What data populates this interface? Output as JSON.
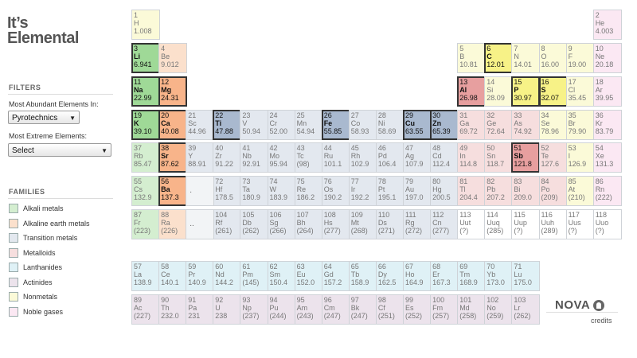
{
  "app": {
    "title_line1": "It’s",
    "title_line2": "Elemental"
  },
  "filters": {
    "heading": "FILTERS",
    "abundant_label": "Most Abundant Elements In:",
    "abundant_value": "Pyrotechnics",
    "extreme_label": "Most Extreme Elements:",
    "extreme_value": "Select"
  },
  "families": {
    "heading": "FAMILIES",
    "items": [
      {
        "key": "alkali",
        "label": "Alkali metals",
        "color": "#d4eed0"
      },
      {
        "key": "alkaline",
        "label": "Alkaline earth metals",
        "color": "#fbe0cc"
      },
      {
        "key": "transition",
        "label": "Transition metals",
        "color": "#e3e8ef"
      },
      {
        "key": "metalloid",
        "label": "Metalloids",
        "color": "#f6dede"
      },
      {
        "key": "lanthanide",
        "label": "Lanthanides",
        "color": "#dff1f6"
      },
      {
        "key": "actinide",
        "label": "Actinides",
        "color": "#ece3ec"
      },
      {
        "key": "nonmetal",
        "label": "Nonmetals",
        "color": "#fbfad8"
      },
      {
        "key": "noble",
        "label": "Noble gases",
        "color": "#fbe8f3"
      }
    ]
  },
  "placeholders": [
    {
      "row": 6,
      "col": 3,
      "text": "."
    },
    {
      "row": 7,
      "col": 3,
      "text": ".."
    }
  ],
  "elements": [
    {
      "n": "1",
      "s": "H",
      "m": "1.008",
      "row": 1,
      "col": 1,
      "cat": "nonmetal"
    },
    {
      "n": "2",
      "s": "He",
      "m": "4.003",
      "row": 1,
      "col": 18,
      "cat": "noble"
    },
    {
      "n": "3",
      "s": "Li",
      "m": "6.941",
      "row": 2,
      "col": 1,
      "cat": "alkali",
      "hl": true
    },
    {
      "n": "4",
      "s": "Be",
      "m": "9.012",
      "row": 2,
      "col": 2,
      "cat": "alkaline"
    },
    {
      "n": "5",
      "s": "B",
      "m": "10.81",
      "row": 2,
      "col": 13,
      "cat": "nonmetal"
    },
    {
      "n": "6",
      "s": "C",
      "m": "12.01",
      "row": 2,
      "col": 14,
      "cat": "nonmetal",
      "hl": true
    },
    {
      "n": "7",
      "s": "N",
      "m": "14.01",
      "row": 2,
      "col": 15,
      "cat": "nonmetal"
    },
    {
      "n": "8",
      "s": "O",
      "m": "16.00",
      "row": 2,
      "col": 16,
      "cat": "nonmetal"
    },
    {
      "n": "9",
      "s": "F",
      "m": "19.00",
      "row": 2,
      "col": 17,
      "cat": "nonmetal"
    },
    {
      "n": "10",
      "s": "Ne",
      "m": "20.18",
      "row": 2,
      "col": 18,
      "cat": "noble"
    },
    {
      "n": "11",
      "s": "Na",
      "m": "22.99",
      "row": 3,
      "col": 1,
      "cat": "alkali",
      "hl": true
    },
    {
      "n": "12",
      "s": "Mg",
      "m": "24.31",
      "row": 3,
      "col": 2,
      "cat": "alkaline",
      "hl": true
    },
    {
      "n": "13",
      "s": "Al",
      "m": "26.98",
      "row": 3,
      "col": 13,
      "cat": "metalloid",
      "hl": true
    },
    {
      "n": "14",
      "s": "Si",
      "m": "28.09",
      "row": 3,
      "col": 14,
      "cat": "nonmetal"
    },
    {
      "n": "15",
      "s": "P",
      "m": "30.97",
      "row": 3,
      "col": 15,
      "cat": "nonmetal",
      "hl": true
    },
    {
      "n": "16",
      "s": "S",
      "m": "32.07",
      "row": 3,
      "col": 16,
      "cat": "nonmetal",
      "hl": true
    },
    {
      "n": "17",
      "s": "Cl",
      "m": "35.45",
      "row": 3,
      "col": 17,
      "cat": "nonmetal"
    },
    {
      "n": "18",
      "s": "Ar",
      "m": "39.95",
      "row": 3,
      "col": 18,
      "cat": "noble"
    },
    {
      "n": "19",
      "s": "K",
      "m": "39.10",
      "row": 4,
      "col": 1,
      "cat": "alkali",
      "hl": true
    },
    {
      "n": "20",
      "s": "Ca",
      "m": "40.08",
      "row": 4,
      "col": 2,
      "cat": "alkaline",
      "hl": true
    },
    {
      "n": "21",
      "s": "Sc",
      "m": "44.96",
      "row": 4,
      "col": 3,
      "cat": "transition"
    },
    {
      "n": "22",
      "s": "Ti",
      "m": "47.88",
      "row": 4,
      "col": 4,
      "cat": "transition",
      "hl": true
    },
    {
      "n": "23",
      "s": "V",
      "m": "50.94",
      "row": 4,
      "col": 5,
      "cat": "transition"
    },
    {
      "n": "24",
      "s": "Cr",
      "m": "52.00",
      "row": 4,
      "col": 6,
      "cat": "transition"
    },
    {
      "n": "25",
      "s": "Mn",
      "m": "54.94",
      "row": 4,
      "col": 7,
      "cat": "transition"
    },
    {
      "n": "26",
      "s": "Fe",
      "m": "55.85",
      "row": 4,
      "col": 8,
      "cat": "transition",
      "hl": true
    },
    {
      "n": "27",
      "s": "Co",
      "m": "58.93",
      "row": 4,
      "col": 9,
      "cat": "transition"
    },
    {
      "n": "28",
      "s": "Ni",
      "m": "58.69",
      "row": 4,
      "col": 10,
      "cat": "transition"
    },
    {
      "n": "29",
      "s": "Cu",
      "m": "63.55",
      "row": 4,
      "col": 11,
      "cat": "transition",
      "hl": true
    },
    {
      "n": "30",
      "s": "Zn",
      "m": "65.39",
      "row": 4,
      "col": 12,
      "cat": "transition",
      "hl": true
    },
    {
      "n": "31",
      "s": "Ga",
      "m": "69.72",
      "row": 4,
      "col": 13,
      "cat": "metalloid"
    },
    {
      "n": "32",
      "s": "Ge",
      "m": "72.64",
      "row": 4,
      "col": 14,
      "cat": "metalloid"
    },
    {
      "n": "33",
      "s": "As",
      "m": "74.92",
      "row": 4,
      "col": 15,
      "cat": "metalloid"
    },
    {
      "n": "34",
      "s": "Se",
      "m": "78.96",
      "row": 4,
      "col": 16,
      "cat": "nonmetal"
    },
    {
      "n": "35",
      "s": "Br",
      "m": "79.90",
      "row": 4,
      "col": 17,
      "cat": "nonmetal"
    },
    {
      "n": "36",
      "s": "Kr",
      "m": "83.79",
      "row": 4,
      "col": 18,
      "cat": "noble"
    },
    {
      "n": "37",
      "s": "Rb",
      "m": "85.47",
      "row": 5,
      "col": 1,
      "cat": "alkali"
    },
    {
      "n": "38",
      "s": "Sr",
      "m": "87.62",
      "row": 5,
      "col": 2,
      "cat": "alkaline",
      "hl": true
    },
    {
      "n": "39",
      "s": "Y",
      "m": "88.91",
      "row": 5,
      "col": 3,
      "cat": "transition"
    },
    {
      "n": "40",
      "s": "Zr",
      "m": "91.22",
      "row": 5,
      "col": 4,
      "cat": "transition"
    },
    {
      "n": "41",
      "s": "Nb",
      "m": "92.91",
      "row": 5,
      "col": 5,
      "cat": "transition"
    },
    {
      "n": "42",
      "s": "Mo",
      "m": "95.94",
      "row": 5,
      "col": 6,
      "cat": "transition"
    },
    {
      "n": "43",
      "s": "Tc",
      "m": "(98)",
      "row": 5,
      "col": 7,
      "cat": "transition"
    },
    {
      "n": "44",
      "s": "Ru",
      "m": "101.1",
      "row": 5,
      "col": 8,
      "cat": "transition"
    },
    {
      "n": "45",
      "s": "Rh",
      "m": "102.9",
      "row": 5,
      "col": 9,
      "cat": "transition"
    },
    {
      "n": "46",
      "s": "Pd",
      "m": "106.4",
      "row": 5,
      "col": 10,
      "cat": "transition"
    },
    {
      "n": "47",
      "s": "Ag",
      "m": "107.9",
      "row": 5,
      "col": 11,
      "cat": "transition"
    },
    {
      "n": "48",
      "s": "Cd",
      "m": "112.4",
      "row": 5,
      "col": 12,
      "cat": "transition"
    },
    {
      "n": "49",
      "s": "In",
      "m": "114.8",
      "row": 5,
      "col": 13,
      "cat": "metalloid"
    },
    {
      "n": "50",
      "s": "Sn",
      "m": "118.7",
      "row": 5,
      "col": 14,
      "cat": "metalloid"
    },
    {
      "n": "51",
      "s": "Sb",
      "m": "121.8",
      "row": 5,
      "col": 15,
      "cat": "metalloid",
      "hl": true
    },
    {
      "n": "52",
      "s": "Te",
      "m": "127.6",
      "row": 5,
      "col": 16,
      "cat": "metalloid"
    },
    {
      "n": "53",
      "s": "I",
      "m": "126.9",
      "row": 5,
      "col": 17,
      "cat": "nonmetal"
    },
    {
      "n": "54",
      "s": "Xe",
      "m": "131.3",
      "row": 5,
      "col": 18,
      "cat": "noble"
    },
    {
      "n": "55",
      "s": "Cs",
      "m": "132.9",
      "row": 6,
      "col": 1,
      "cat": "alkali"
    },
    {
      "n": "56",
      "s": "Ba",
      "m": "137.3",
      "row": 6,
      "col": 2,
      "cat": "alkaline",
      "hl": true
    },
    {
      "n": "72",
      "s": "Hf",
      "m": "178.5",
      "row": 6,
      "col": 4,
      "cat": "transition"
    },
    {
      "n": "73",
      "s": "Ta",
      "m": "180.9",
      "row": 6,
      "col": 5,
      "cat": "transition"
    },
    {
      "n": "74",
      "s": "W",
      "m": "183.9",
      "row": 6,
      "col": 6,
      "cat": "transition"
    },
    {
      "n": "75",
      "s": "Re",
      "m": "186.2",
      "row": 6,
      "col": 7,
      "cat": "transition"
    },
    {
      "n": "76",
      "s": "Os",
      "m": "190.2",
      "row": 6,
      "col": 8,
      "cat": "transition"
    },
    {
      "n": "77",
      "s": "Ir",
      "m": "192.2",
      "row": 6,
      "col": 9,
      "cat": "transition"
    },
    {
      "n": "78",
      "s": "Pt",
      "m": "195.1",
      "row": 6,
      "col": 10,
      "cat": "transition"
    },
    {
      "n": "79",
      "s": "Au",
      "m": "197.0",
      "row": 6,
      "col": 11,
      "cat": "transition"
    },
    {
      "n": "80",
      "s": "Hg",
      "m": "200.5",
      "row": 6,
      "col": 12,
      "cat": "transition"
    },
    {
      "n": "81",
      "s": "Tl",
      "m": "204.4",
      "row": 6,
      "col": 13,
      "cat": "metalloid"
    },
    {
      "n": "82",
      "s": "Pb",
      "m": "207.2",
      "row": 6,
      "col": 14,
      "cat": "metalloid"
    },
    {
      "n": "83",
      "s": "Bi",
      "m": "209.0",
      "row": 6,
      "col": 15,
      "cat": "metalloid"
    },
    {
      "n": "84",
      "s": "Po",
      "m": "(209)",
      "row": 6,
      "col": 16,
      "cat": "metalloid"
    },
    {
      "n": "85",
      "s": "At",
      "m": "(210)",
      "row": 6,
      "col": 17,
      "cat": "nonmetal"
    },
    {
      "n": "86",
      "s": "Rn",
      "m": "(222)",
      "row": 6,
      "col": 18,
      "cat": "noble"
    },
    {
      "n": "87",
      "s": "Fr",
      "m": "(223)",
      "row": 7,
      "col": 1,
      "cat": "alkali"
    },
    {
      "n": "88",
      "s": "Ra",
      "m": "(226)",
      "row": 7,
      "col": 2,
      "cat": "alkaline"
    },
    {
      "n": "104",
      "s": "Rf",
      "m": "(261)",
      "row": 7,
      "col": 4,
      "cat": "transition"
    },
    {
      "n": "105",
      "s": "Db",
      "m": "(262)",
      "row": 7,
      "col": 5,
      "cat": "transition"
    },
    {
      "n": "106",
      "s": "Sg",
      "m": "(266)",
      "row": 7,
      "col": 6,
      "cat": "transition"
    },
    {
      "n": "107",
      "s": "Bh",
      "m": "(264)",
      "row": 7,
      "col": 7,
      "cat": "transition"
    },
    {
      "n": "108",
      "s": "Hs",
      "m": "(277)",
      "row": 7,
      "col": 8,
      "cat": "transition"
    },
    {
      "n": "109",
      "s": "Mt",
      "m": "(268)",
      "row": 7,
      "col": 9,
      "cat": "transition"
    },
    {
      "n": "110",
      "s": "Ds",
      "m": "(271)",
      "row": 7,
      "col": 10,
      "cat": "transition"
    },
    {
      "n": "111",
      "s": "Rg",
      "m": "(272)",
      "row": 7,
      "col": 11,
      "cat": "transition"
    },
    {
      "n": "112",
      "s": "Cn",
      "m": "(277)",
      "row": 7,
      "col": 12,
      "cat": "transition"
    },
    {
      "n": "113",
      "s": "Uut",
      "m": "(?)",
      "row": 7,
      "col": 13,
      "cat": "unknown"
    },
    {
      "n": "114",
      "s": "Uuq",
      "m": "(285)",
      "row": 7,
      "col": 14,
      "cat": "unknown"
    },
    {
      "n": "115",
      "s": "Uup",
      "m": "(?)",
      "row": 7,
      "col": 15,
      "cat": "unknown"
    },
    {
      "n": "116",
      "s": "Uuh",
      "m": "(289)",
      "row": 7,
      "col": 16,
      "cat": "unknown"
    },
    {
      "n": "117",
      "s": "Uus",
      "m": "(?)",
      "row": 7,
      "col": 17,
      "cat": "unknown"
    },
    {
      "n": "118",
      "s": "Uuo",
      "m": "(?)",
      "row": 7,
      "col": 18,
      "cat": "unknown"
    },
    {
      "n": "57",
      "s": "La",
      "m": "138.9",
      "row": 8,
      "col": 1,
      "cat": "lanthanide"
    },
    {
      "n": "58",
      "s": "Ce",
      "m": "140.1",
      "row": 8,
      "col": 2,
      "cat": "lanthanide"
    },
    {
      "n": "59",
      "s": "Pr",
      "m": "140.9",
      "row": 8,
      "col": 3,
      "cat": "lanthanide"
    },
    {
      "n": "60",
      "s": "Nd",
      "m": "144.2",
      "row": 8,
      "col": 4,
      "cat": "lanthanide"
    },
    {
      "n": "61",
      "s": "Pm",
      "m": "(145)",
      "row": 8,
      "col": 5,
      "cat": "lanthanide"
    },
    {
      "n": "62",
      "s": "Sm",
      "m": "150.4",
      "row": 8,
      "col": 6,
      "cat": "lanthanide"
    },
    {
      "n": "63",
      "s": "Eu",
      "m": "152.0",
      "row": 8,
      "col": 7,
      "cat": "lanthanide"
    },
    {
      "n": "64",
      "s": "Gd",
      "m": "157.2",
      "row": 8,
      "col": 8,
      "cat": "lanthanide"
    },
    {
      "n": "65",
      "s": "Tb",
      "m": "158.9",
      "row": 8,
      "col": 9,
      "cat": "lanthanide"
    },
    {
      "n": "66",
      "s": "Dy",
      "m": "162.5",
      "row": 8,
      "col": 10,
      "cat": "lanthanide"
    },
    {
      "n": "67",
      "s": "Ho",
      "m": "164.9",
      "row": 8,
      "col": 11,
      "cat": "lanthanide"
    },
    {
      "n": "68",
      "s": "Er",
      "m": "167.3",
      "row": 8,
      "col": 12,
      "cat": "lanthanide"
    },
    {
      "n": "69",
      "s": "Tm",
      "m": "168.9",
      "row": 8,
      "col": 13,
      "cat": "lanthanide"
    },
    {
      "n": "70",
      "s": "Yb",
      "m": "173.0",
      "row": 8,
      "col": 14,
      "cat": "lanthanide"
    },
    {
      "n": "71",
      "s": "Lu",
      "m": "175.0",
      "row": 8,
      "col": 15,
      "cat": "lanthanide"
    },
    {
      "n": "89",
      "s": "Ac",
      "m": "(227)",
      "row": 9,
      "col": 1,
      "cat": "actinide"
    },
    {
      "n": "90",
      "s": "Th",
      "m": "232.0",
      "row": 9,
      "col": 2,
      "cat": "actinide"
    },
    {
      "n": "91",
      "s": "Pa",
      "m": "231",
      "row": 9,
      "col": 3,
      "cat": "actinide"
    },
    {
      "n": "92",
      "s": "U",
      "m": "238",
      "row": 9,
      "col": 4,
      "cat": "actinide"
    },
    {
      "n": "93",
      "s": "Np",
      "m": "(237)",
      "row": 9,
      "col": 5,
      "cat": "actinide"
    },
    {
      "n": "94",
      "s": "Pu",
      "m": "(244)",
      "row": 9,
      "col": 6,
      "cat": "actinide"
    },
    {
      "n": "95",
      "s": "Am",
      "m": "(243)",
      "row": 9,
      "col": 7,
      "cat": "actinide"
    },
    {
      "n": "96",
      "s": "Cm",
      "m": "(247)",
      "row": 9,
      "col": 8,
      "cat": "actinide"
    },
    {
      "n": "97",
      "s": "Bk",
      "m": "(247)",
      "row": 9,
      "col": 9,
      "cat": "actinide"
    },
    {
      "n": "98",
      "s": "Cf",
      "m": "(251)",
      "row": 9,
      "col": 10,
      "cat": "actinide"
    },
    {
      "n": "99",
      "s": "Es",
      "m": "(252)",
      "row": 9,
      "col": 11,
      "cat": "actinide"
    },
    {
      "n": "100",
      "s": "Fm",
      "m": "(257)",
      "row": 9,
      "col": 12,
      "cat": "actinide"
    },
    {
      "n": "101",
      "s": "Md",
      "m": "(258)",
      "row": 9,
      "col": 13,
      "cat": "actinide"
    },
    {
      "n": "102",
      "s": "No",
      "m": "(259)",
      "row": 9,
      "col": 14,
      "cat": "actinide"
    },
    {
      "n": "103",
      "s": "Lr",
      "m": "(262)",
      "row": 9,
      "col": 15,
      "cat": "actinide"
    }
  ],
  "footer": {
    "logo_text": "NOVA",
    "logo_icon": "pbs-logo-icon",
    "credits_label": "credits"
  }
}
